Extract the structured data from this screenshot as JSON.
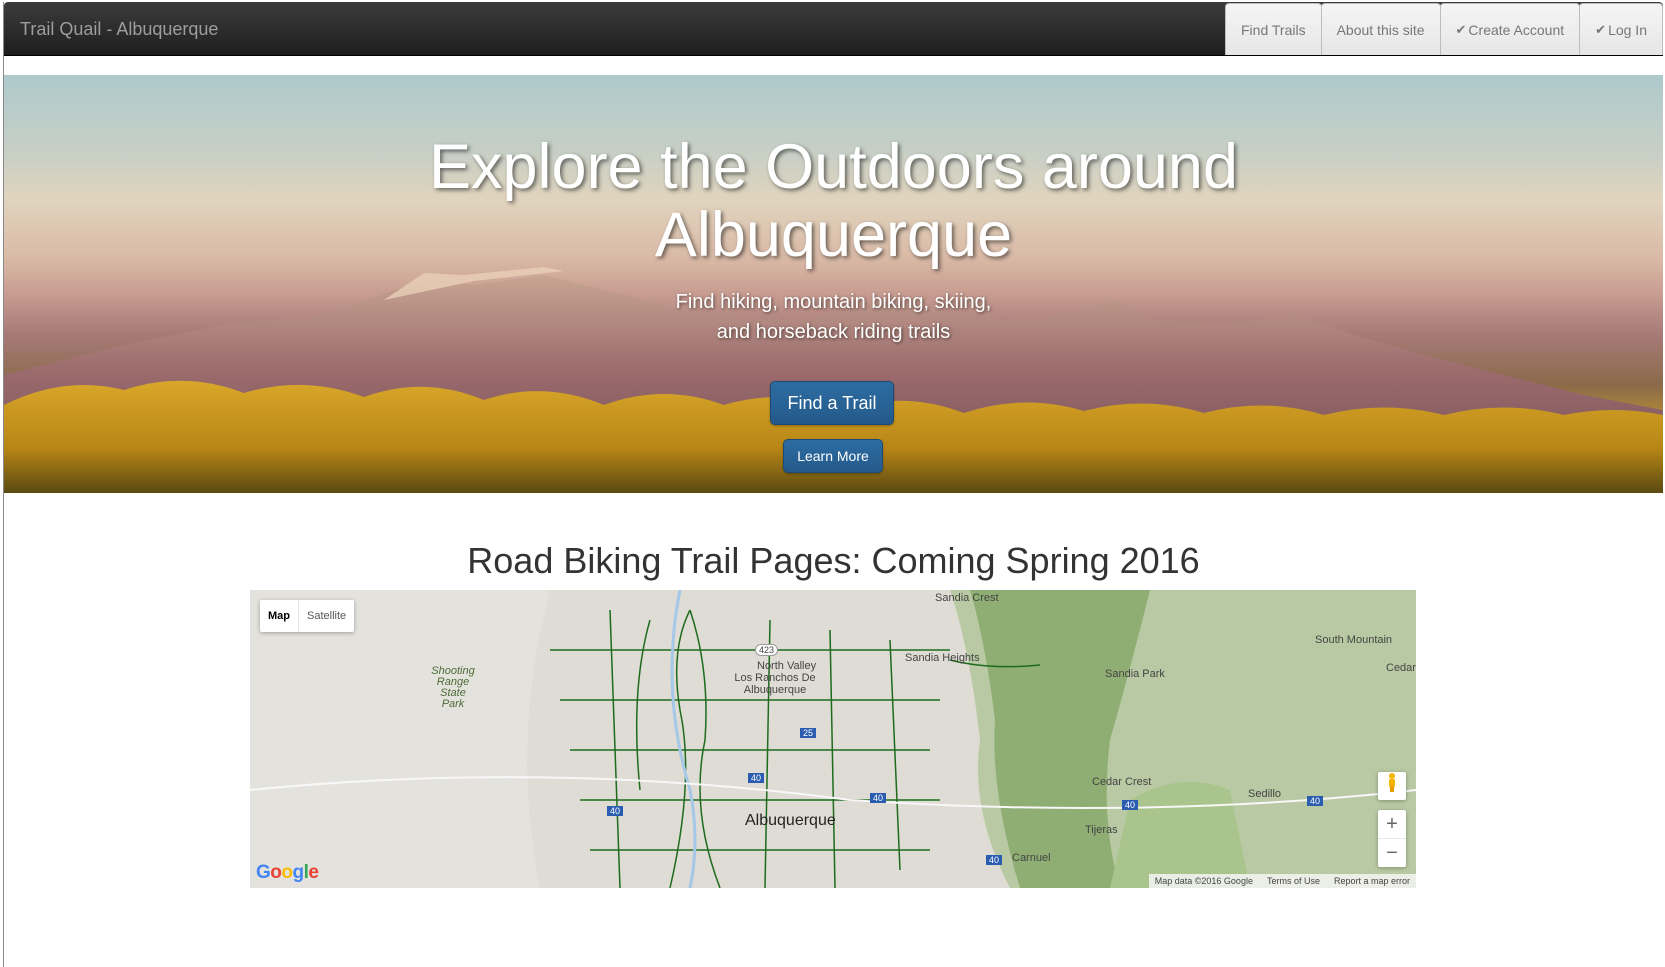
{
  "navbar": {
    "brand": "Trail Quail - Albuquerque",
    "links": [
      {
        "label": "Find Trails",
        "check": false
      },
      {
        "label": "About this site",
        "check": false
      },
      {
        "label": "Create Account",
        "check": true
      },
      {
        "label": "Log In",
        "check": true
      }
    ]
  },
  "hero": {
    "title_line1": "Explore the Outdoors around",
    "title_line2": "Albuquerque",
    "subtitle_line1": "Find hiking, mountain biking, skiing,",
    "subtitle_line2": "and horseback riding trails",
    "primary_button": "Find a Trail",
    "secondary_button": "Learn More"
  },
  "section": {
    "title": "Road Biking Trail Pages: Coming Spring 2016"
  },
  "map": {
    "type_options": [
      "Map",
      "Satellite"
    ],
    "selected_type": "Map",
    "labels": {
      "city": "Albuquerque",
      "sandia_crest": "Sandia Crest",
      "sandia_heights": "Sandia Heights",
      "sandia_park": "Sandia Park",
      "south_mountain": "South Mountain",
      "cedar": "Cedar",
      "north_valley": "North Valley",
      "los_ranchos": "Los Ranchos De Albuquerque",
      "shooting_range": "Shooting Range State Park",
      "cedar_crest": "Cedar Crest",
      "sedillo": "Sedillo",
      "tijeras": "Tijeras",
      "carnuel": "Carnuel",
      "hwy_423": "423",
      "hwy_25": "25",
      "hwy_40": "40"
    },
    "zoom_in": "+",
    "zoom_out": "−",
    "attribution": {
      "map_data": "Map data ©2016 Google",
      "terms": "Terms of Use",
      "report": "Report a map error"
    },
    "logo": "Google",
    "colors": {
      "trail": "#1e6b1e",
      "terrain": "#9ebc84"
    }
  },
  "colors": {
    "navbar_bg": "#2a2a2a",
    "button_primary": "#286090"
  }
}
